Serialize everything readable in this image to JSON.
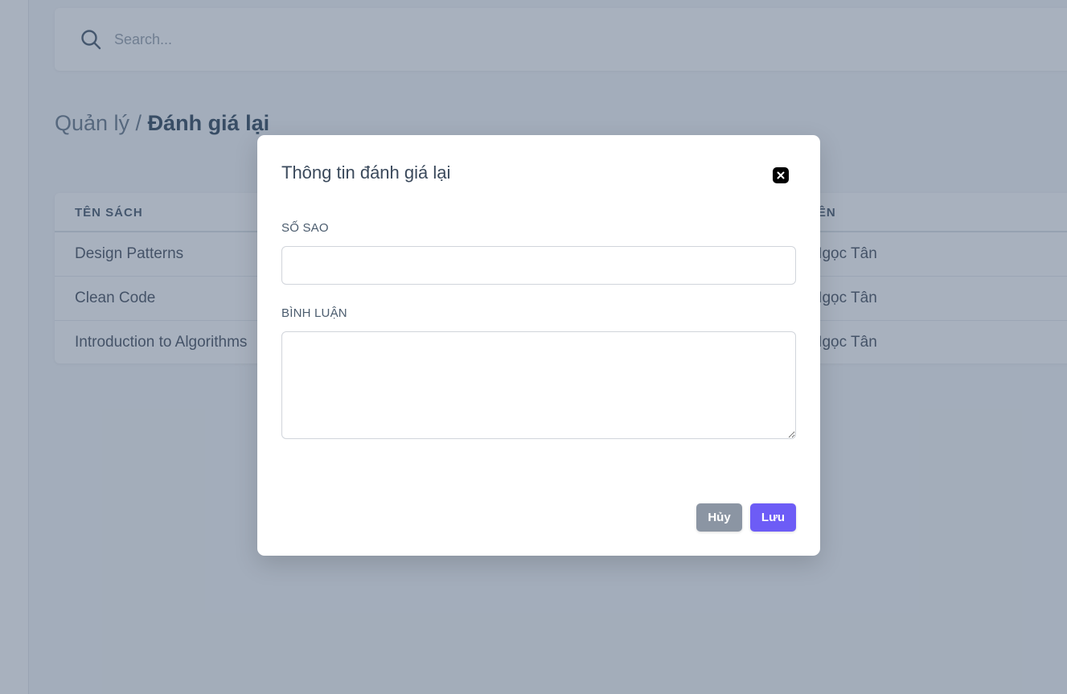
{
  "search": {
    "placeholder": "Search..."
  },
  "breadcrumb": {
    "parent": "Quản lý / ",
    "current": "Đánh giá lại"
  },
  "table": {
    "headers": {
      "book": "TÊN SÁCH",
      "member": "THÀNH VIÊN"
    },
    "rows": [
      {
        "book": "Design Patterns",
        "member": "Nguyễn Ngọc Tân"
      },
      {
        "book": "Clean Code",
        "member": "Nguyễn Ngọc Tân"
      },
      {
        "book": "Introduction to Algorithms",
        "member": "Nguyễn Ngọc Tân"
      }
    ]
  },
  "modal": {
    "title": "Thông tin đánh giá lại",
    "stars_label": "SỐ SAO",
    "stars_value": "",
    "comment_label": "BÌNH LUẬN",
    "comment_value": "",
    "cancel_label": "Hủy",
    "save_label": "Lưu"
  },
  "colors": {
    "accent": "#6d5cf6",
    "cancel": "#8b95a3",
    "overlay": "rgba(62, 82, 110, 0.45)"
  }
}
